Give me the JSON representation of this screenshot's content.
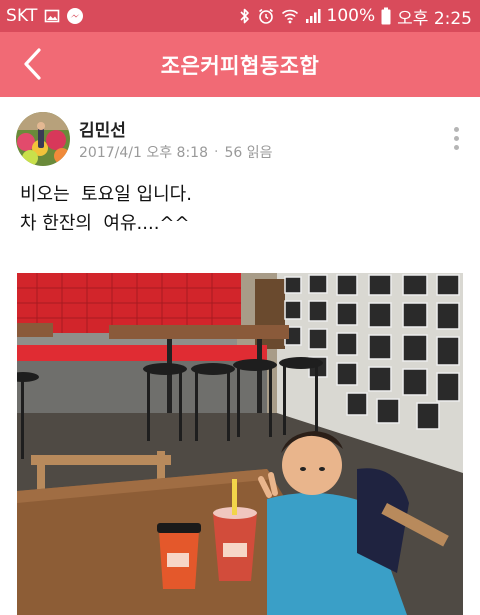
{
  "status_bar": {
    "carrier": "SKT",
    "icons": [
      "image-notification-icon",
      "messenger-icon",
      "bluetooth-icon",
      "alarm-icon",
      "wifi-icon",
      "signal-icon",
      "battery-icon"
    ],
    "battery": "100%",
    "time": "오후 2:25"
  },
  "header": {
    "back_icon": "chevron-left-icon",
    "title": "조은커피협동조합"
  },
  "post": {
    "author": "김민선",
    "date": "2017/4/1 오후 8:18",
    "separator": "·",
    "views": "56 읽음",
    "more_icon": "more-vertical-icon",
    "body_lines": [
      "비오는  토요일 입니다.",
      "차 한잔의  여유....^^"
    ]
  },
  "colors": {
    "status_bar": "#d94b5b",
    "header": "#f16a75"
  }
}
